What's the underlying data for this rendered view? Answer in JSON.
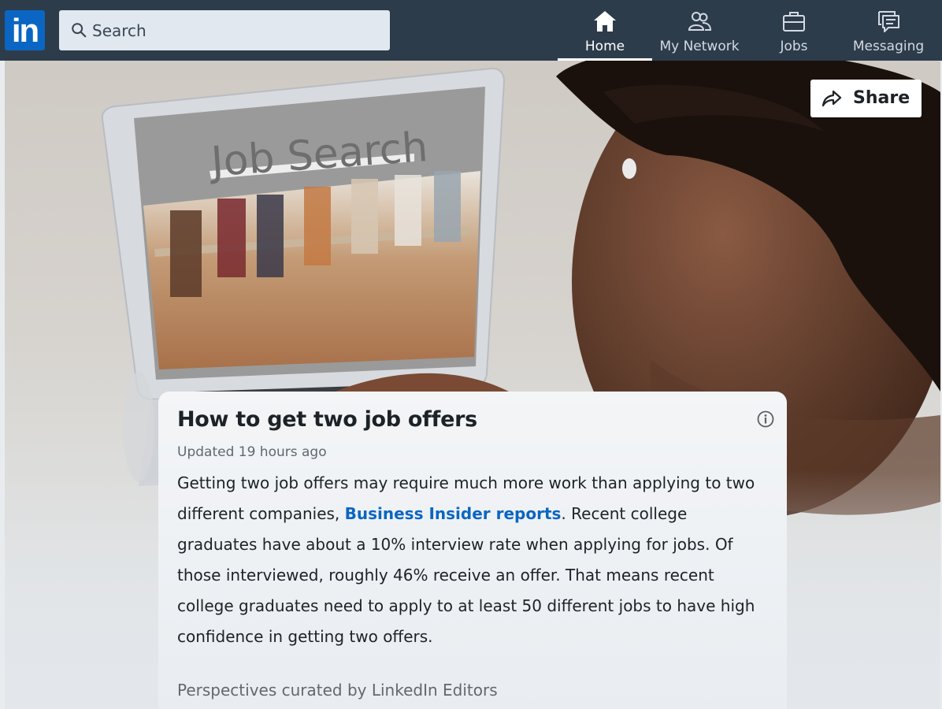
{
  "header": {
    "logo_text": "in",
    "search": {
      "placeholder": "Search"
    },
    "nav": [
      {
        "label": "Home",
        "icon": "home-icon",
        "active": true
      },
      {
        "label": "My Network",
        "icon": "network-icon",
        "active": false
      },
      {
        "label": "Jobs",
        "icon": "briefcase-icon",
        "active": false
      },
      {
        "label": "Messaging",
        "icon": "messaging-icon",
        "active": false
      }
    ]
  },
  "hero": {
    "image_text": "Job Search",
    "share_label": "Share"
  },
  "article": {
    "title": "How to get two job offers",
    "updated": "Updated 19 hours ago",
    "body_part1": "Getting two job offers may require much more work than applying to two different companies, ",
    "link_text": "Business Insider reports",
    "body_part2": ". Recent college graduates have about a 10% interview rate when applying for jobs. Of those interviewed, roughly 46% receive an offer. That means recent college graduates need to apply to at least 50 different jobs to have high confidence in getting two offers.",
    "curated_by": "Perspectives curated by LinkedIn Editors"
  },
  "colors": {
    "nav_bg": "#2d3c4b",
    "brand": "#0a66c2",
    "link": "#0a66c2"
  }
}
